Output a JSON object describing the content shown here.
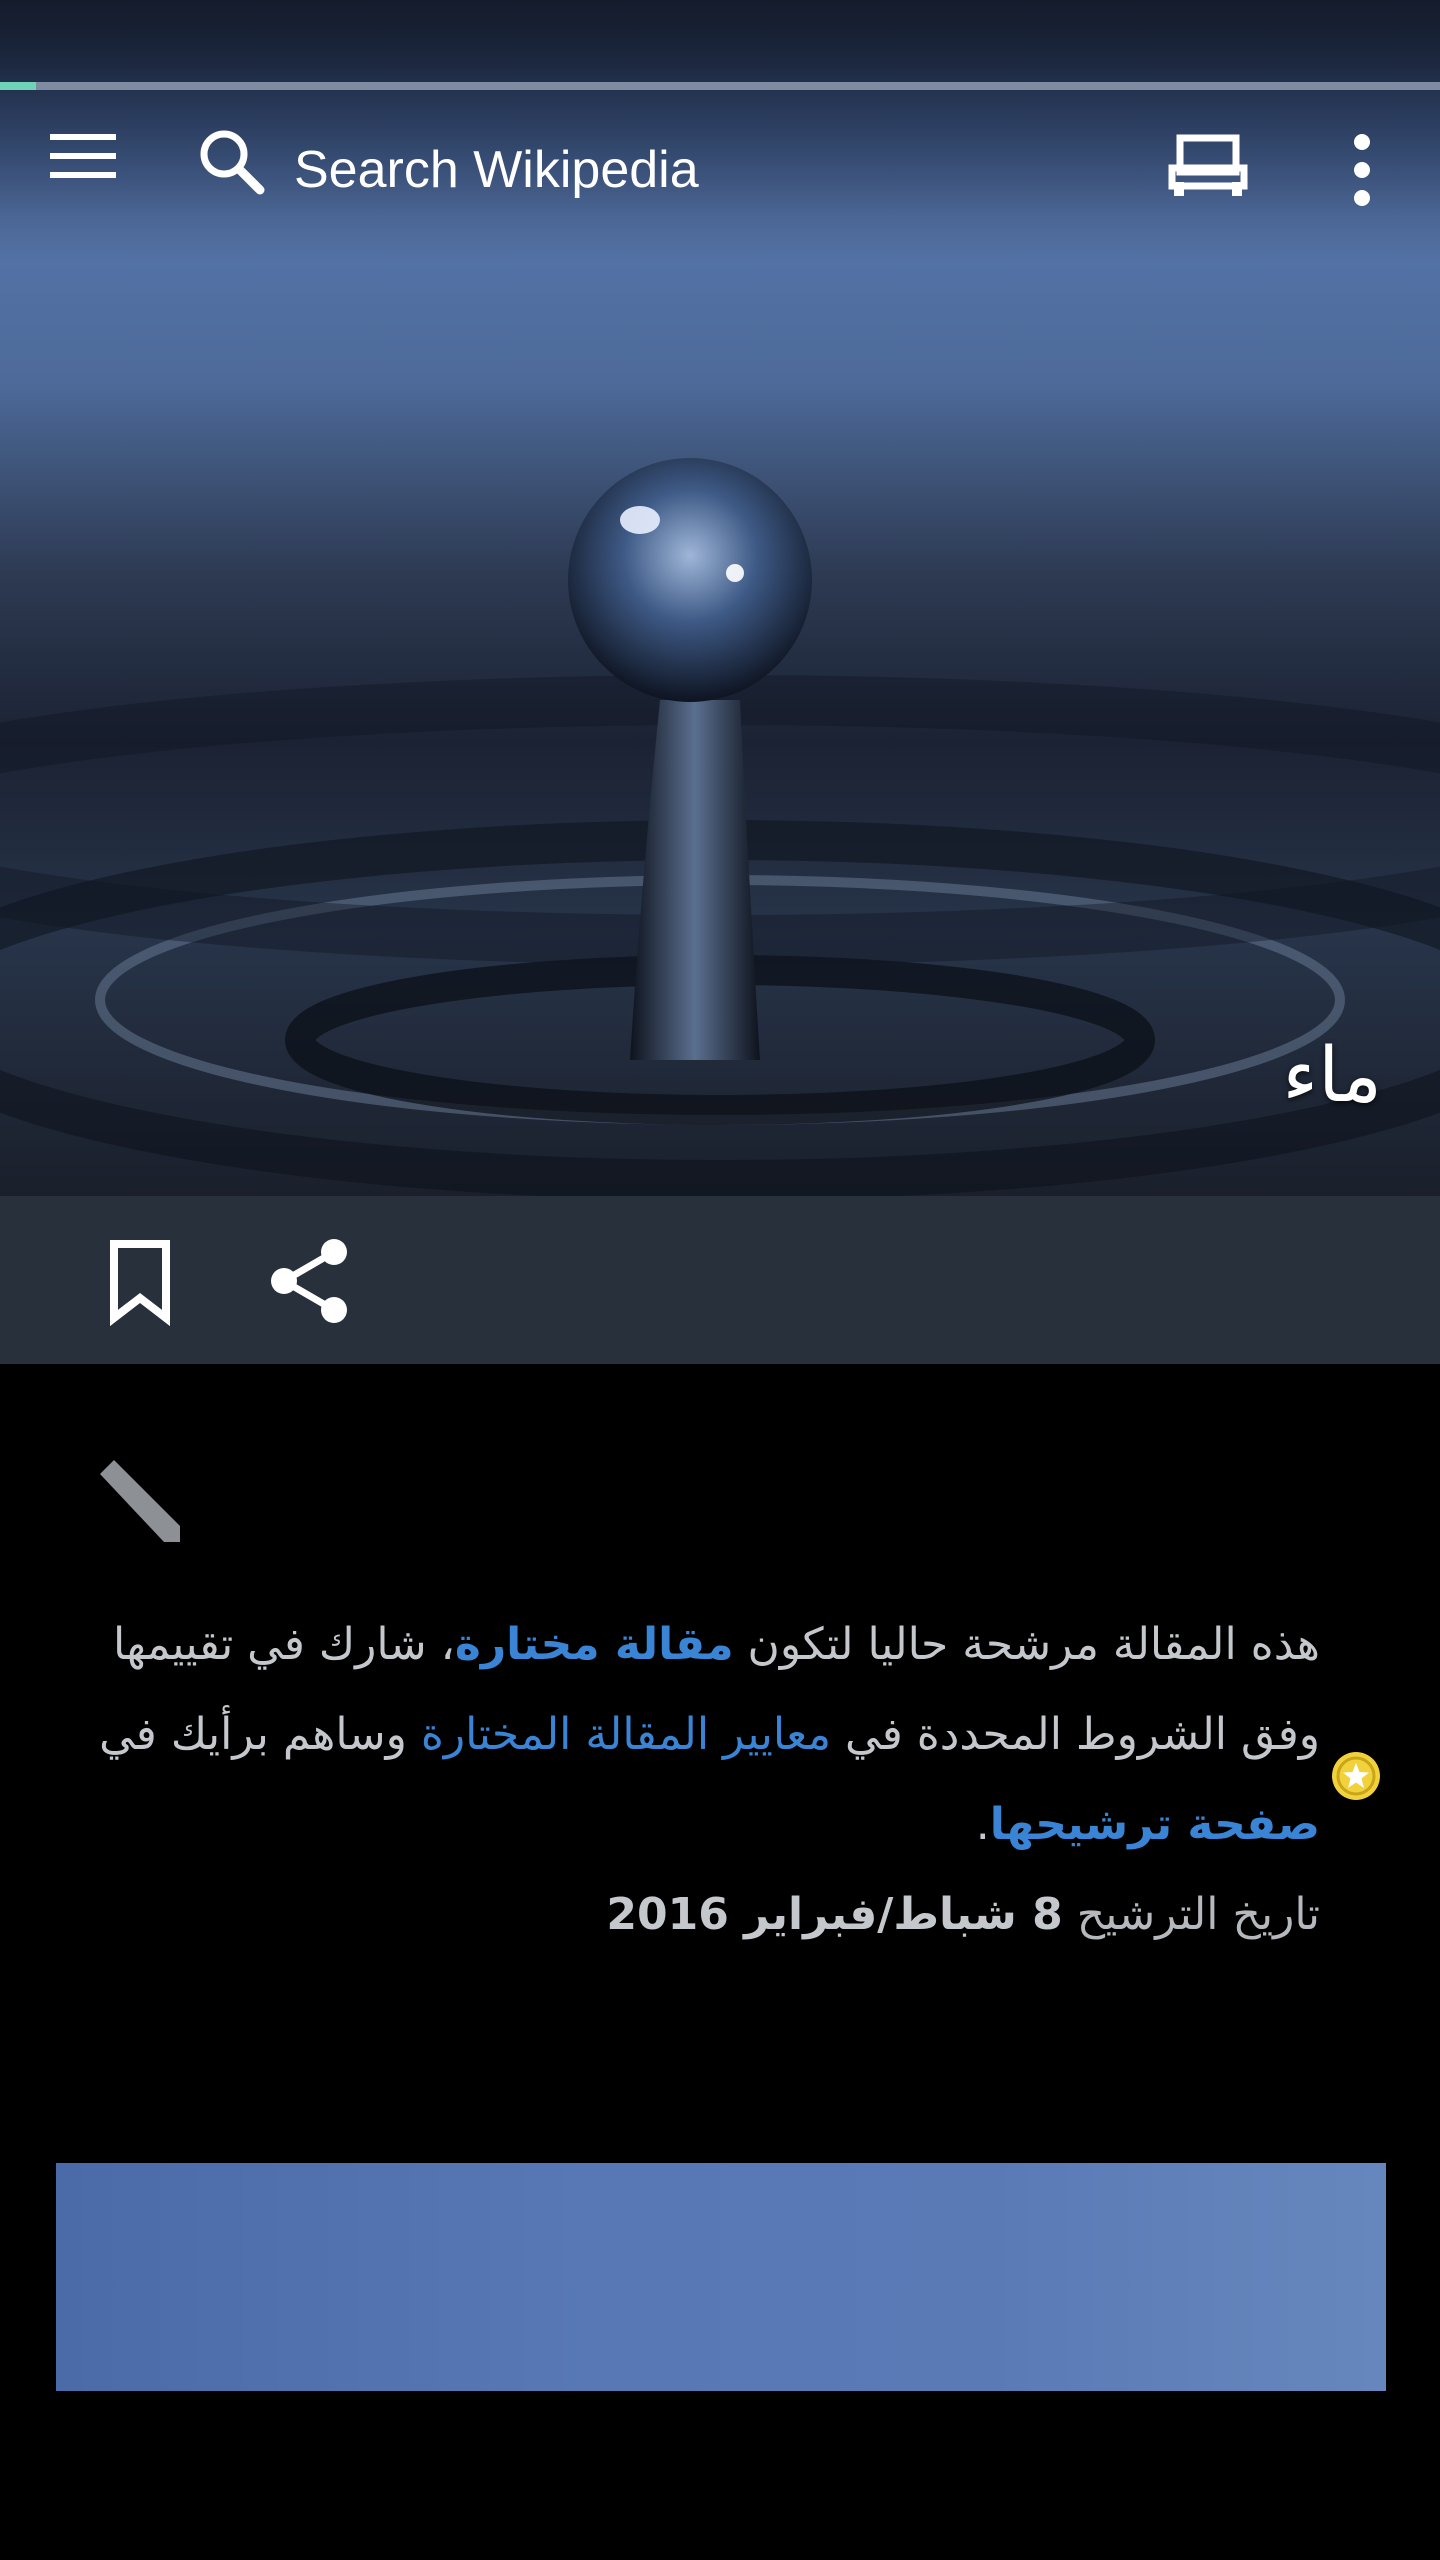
{
  "toolbar": {
    "menu_icon": "hamburger-menu-icon",
    "search_icon": "search-icon",
    "search_placeholder": "Search Wikipedia",
    "reading_list_icon": "reading-list-icon",
    "overflow_icon": "more-vert-icon"
  },
  "load_progress": 0.025,
  "article": {
    "title": "ماء",
    "lead_image_description": "water droplet splash"
  },
  "actions": {
    "bookmark_icon": "bookmark-icon",
    "share_icon": "share-icon"
  },
  "notice": {
    "edit_icon": "pencil-icon",
    "badge_icon": "star-icon",
    "text_1": "هذه المقالة مرشحة حاليا لتكون ",
    "link_featured": "مقالة مختارة",
    "text_2": "، شارك في تقييمها وفق الشروط المحددة في ",
    "link_criteria": "معايير المقالة المختارة",
    "text_3": " وساهم برأيك في ",
    "link_nomination": "صفحة ترشيحها",
    "text_4": ".",
    "date_label": "تاريخ الترشيح ",
    "date_value": "8 شباط/فبراير 2016"
  },
  "colors": {
    "link": "#3a84d6",
    "progress": "#6fd3b8",
    "action_bar": "#27303b",
    "badge": "#f2d23c"
  }
}
